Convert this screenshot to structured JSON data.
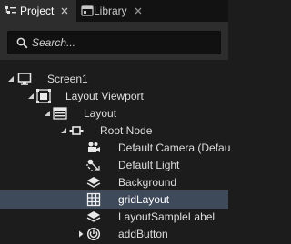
{
  "tabs": [
    {
      "label": "Project",
      "icon": "project-icon",
      "active": true
    },
    {
      "label": "Library",
      "icon": "library-icon",
      "active": false
    }
  ],
  "search": {
    "placeholder": "Search..."
  },
  "tree": {
    "nodes": [
      {
        "label": "Screen1",
        "icon": "monitor-icon",
        "expanded": true
      },
      {
        "label": "Layout Viewport",
        "icon": "viewport-icon",
        "expanded": true
      },
      {
        "label": "Layout",
        "icon": "layout-icon",
        "expanded": true
      },
      {
        "label": "Root Node",
        "icon": "node-icon",
        "expanded": true
      },
      {
        "label": "Default Camera (Defau",
        "icon": "camera-icon"
      },
      {
        "label": "Default Light",
        "icon": "light-icon"
      },
      {
        "label": "Background",
        "icon": "layer-icon"
      },
      {
        "label": "gridLayout",
        "icon": "grid-icon",
        "selected": true
      },
      {
        "label": "LayoutSampleLabel",
        "icon": "layer-icon"
      },
      {
        "label": "addButton",
        "icon": "button-icon",
        "expanded": false
      }
    ]
  },
  "colors": {
    "selected_row": "#3e4a5a",
    "panel": "#1c1c1c",
    "header": "#2d2d2d"
  }
}
